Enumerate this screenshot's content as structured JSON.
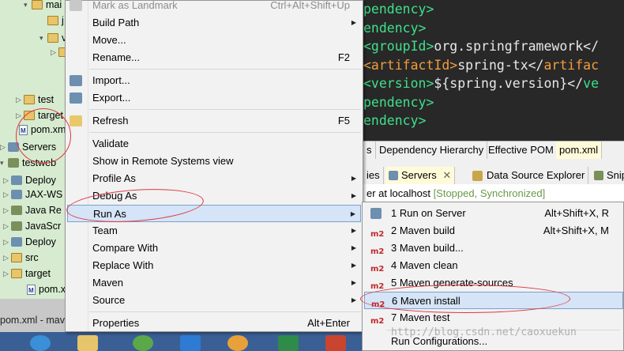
{
  "editor": {
    "lines": [
      {
        "parts": [
          {
            "text": "pendency>",
            "cls": "g"
          }
        ]
      },
      {
        "parts": [
          {
            "text": "endency>",
            "cls": "g"
          }
        ]
      },
      {
        "parts": [
          {
            "text": "<groupId>",
            "cls": "g"
          },
          {
            "text": "org.springframework</",
            "cls": "w"
          }
        ]
      },
      {
        "parts": [
          {
            "text": "<artifactId>",
            "cls": "o"
          },
          {
            "text": "spring-tx</",
            "cls": "w"
          },
          {
            "text": "artifac",
            "cls": "o"
          }
        ]
      },
      {
        "parts": [
          {
            "text": "<version>",
            "cls": "g"
          },
          {
            "text": "${spring.version}</",
            "cls": "w"
          },
          {
            "text": "ve",
            "cls": "g"
          }
        ]
      },
      {
        "parts": [
          {
            "text": "pendency>",
            "cls": "g"
          }
        ]
      },
      {
        "parts": [
          {
            "text": "endency>",
            "cls": "g"
          }
        ]
      }
    ]
  },
  "explorer": {
    "rows": [
      {
        "label": "mai",
        "icon": "folder-icon",
        "arrow": "▾"
      },
      {
        "label": "j",
        "icon": "folder-icon",
        "arrow": ""
      },
      {
        "label": "v",
        "icon": "folder-icon",
        "arrow": "▾"
      },
      {
        "label": "",
        "icon": "folder-icon",
        "arrow": "▷"
      },
      {
        "label": "test",
        "icon": "folder-icon",
        "arrow": "▷"
      },
      {
        "label": "target",
        "icon": "folder-icon",
        "arrow": "▷"
      },
      {
        "label": "pom.xml",
        "icon": "maven-file-icon",
        "arrow": ""
      },
      {
        "label": "Servers",
        "icon": "server-icon",
        "arrow": "▷"
      },
      {
        "label": "testweb",
        "icon": "project-icon",
        "arrow": "▾"
      },
      {
        "label": "Deploy",
        "icon": "deploy-icon",
        "arrow": "▷"
      },
      {
        "label": "JAX-WS",
        "icon": "jaxws-icon",
        "arrow": "▷"
      },
      {
        "label": "Java Re",
        "icon": "library-icon",
        "arrow": "▷"
      },
      {
        "label": "JavaScr",
        "icon": "library-icon",
        "arrow": "▷"
      },
      {
        "label": "Deploy",
        "icon": "deploy-icon",
        "arrow": "▷"
      },
      {
        "label": "src",
        "icon": "folder-icon",
        "arrow": "▷"
      },
      {
        "label": "target",
        "icon": "folder-icon",
        "arrow": "▷"
      },
      {
        "label": "pom.xml",
        "icon": "maven-file-icon",
        "arrow": ""
      }
    ],
    "bottom_tab": "pom.xml - mav"
  },
  "context_menu": {
    "items": [
      {
        "label": "Mark as Landmark",
        "accel": "Ctrl+Alt+Shift+Up",
        "disabled": true,
        "icon": "landmark-icon"
      },
      {
        "label": "Build Path",
        "submenu": true
      },
      {
        "label": "Move...",
        "accel": ""
      },
      {
        "label": "Rename...",
        "accel": "F2"
      },
      {
        "sep": true
      },
      {
        "label": "Import...",
        "icon": "import-icon"
      },
      {
        "label": "Export...",
        "icon": "export-icon"
      },
      {
        "sep": true
      },
      {
        "label": "Refresh",
        "accel": "F5",
        "icon": "refresh-icon"
      },
      {
        "sep": true
      },
      {
        "label": "Validate"
      },
      {
        "label": "Show in Remote Systems view"
      },
      {
        "label": "Profile As",
        "submenu": true
      },
      {
        "label": "Debug As",
        "submenu": true
      },
      {
        "label": "Run As",
        "submenu": true,
        "highlight": true
      },
      {
        "label": "Team",
        "submenu": true
      },
      {
        "label": "Compare With",
        "submenu": true
      },
      {
        "label": "Replace With",
        "submenu": true
      },
      {
        "label": "Maven",
        "submenu": true
      },
      {
        "label": "Source",
        "submenu": true
      },
      {
        "sep": true
      },
      {
        "label": "Properties",
        "accel": "Alt+Enter"
      }
    ]
  },
  "panel": {
    "tabs_top": [
      "s",
      "Dependency Hierarchy",
      "Effective POM",
      "pom.xml"
    ],
    "tabs_views": [
      "ies",
      "Servers",
      "Data Source Explorer",
      "Snip"
    ],
    "server_label": "er at localhost",
    "server_status": "[Stopped, Synchronized]"
  },
  "run_as_menu": {
    "items": [
      {
        "label": "1 Run on Server",
        "accel": "Alt+Shift+X, R",
        "icon": "run-server-icon"
      },
      {
        "label": "2 Maven build",
        "accel": "Alt+Shift+X, M",
        "badge": "m2"
      },
      {
        "label": "3 Maven build...",
        "badge": "m2"
      },
      {
        "label": "4 Maven clean",
        "badge": "m2"
      },
      {
        "label": "5 Maven generate-sources",
        "badge": "m2"
      },
      {
        "label": "6 Maven install",
        "badge": "m2",
        "highlight": true
      },
      {
        "label": "7 Maven test",
        "badge": "m2"
      },
      {
        "sep": true
      },
      {
        "label": "Run Configurations..."
      }
    ]
  },
  "watermark": "http://blog.csdn.net/caoxuekun"
}
